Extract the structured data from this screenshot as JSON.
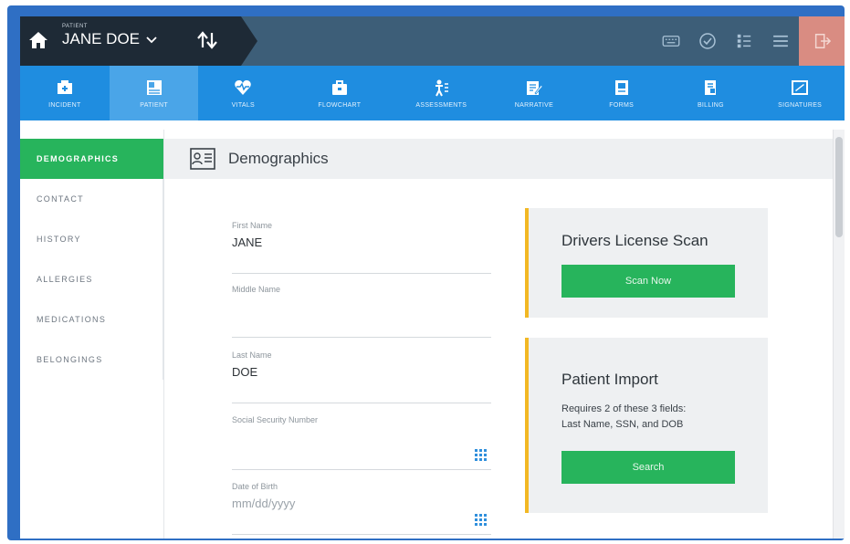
{
  "header": {
    "patient_caption": "PATIENT",
    "patient_name": "JANE DOE",
    "icons": [
      "home-icon",
      "chevron-down-icon",
      "sort-icon",
      "keyboard-icon",
      "check-circle-icon",
      "list-icon",
      "menu-icon",
      "exit-icon"
    ]
  },
  "nav": {
    "tabs": [
      {
        "label": "INCIDENT",
        "icon": "incident-icon"
      },
      {
        "label": "PATIENT",
        "icon": "patient-icon",
        "active": true
      },
      {
        "label": "VITALS",
        "icon": "heart-icon"
      },
      {
        "label": "FLOWCHART",
        "icon": "briefcase-icon"
      },
      {
        "label": "ASSESSMENTS",
        "icon": "body-icon"
      },
      {
        "label": "NARRATIVE",
        "icon": "edit-icon"
      },
      {
        "label": "FORMS",
        "icon": "forms-icon"
      },
      {
        "label": "BILLING",
        "icon": "billing-icon"
      },
      {
        "label": "SIGNATURES",
        "icon": "signature-icon"
      }
    ]
  },
  "sidebar": {
    "items": [
      {
        "label": "DEMOGRAPHICS",
        "active": true
      },
      {
        "label": "CONTACT"
      },
      {
        "label": "HISTORY"
      },
      {
        "label": "ALLERGIES"
      },
      {
        "label": "MEDICATIONS"
      },
      {
        "label": "BELONGINGS"
      }
    ]
  },
  "main": {
    "section_title": "Demographics",
    "fields": {
      "first_name": {
        "label": "First Name",
        "value": "JANE"
      },
      "middle_name": {
        "label": "Middle Name",
        "value": ""
      },
      "last_name": {
        "label": "Last Name",
        "value": "DOE"
      },
      "ssn": {
        "label": "Social Security Number",
        "value": ""
      },
      "dob": {
        "label": "Date of Birth",
        "value": "",
        "placeholder": "mm/dd/yyyy"
      }
    },
    "license_card": {
      "title": "Drivers License Scan",
      "button": "Scan Now"
    },
    "import_card": {
      "title": "Patient Import",
      "text_line1": "Requires 2 of these 3 fields:",
      "text_line2": "Last Name, SSN, and DOB",
      "button": "Search"
    }
  },
  "colors": {
    "nav_blue": "#1f8de0",
    "active_green": "#27b45c",
    "accent_yellow": "#f2b824",
    "frame_blue": "#2f6fc4"
  }
}
